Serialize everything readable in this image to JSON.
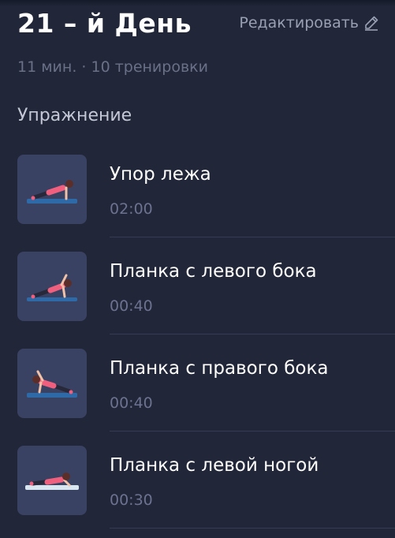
{
  "header": {
    "title": "21 – й День",
    "edit_label": "Редактировать"
  },
  "meta": "11 мин. · 10 тренировки",
  "section_label": "Упражнение",
  "exercises": [
    {
      "name": "Упор лежа",
      "duration": "02:00"
    },
    {
      "name": "Планка с левого бока",
      "duration": "00:40"
    },
    {
      "name": "Планка с правого бока",
      "duration": "00:40"
    },
    {
      "name": "Планка с левой ногой",
      "duration": "00:30"
    }
  ],
  "icons": {
    "edit": "pencil-icon"
  },
  "colors": {
    "background": "#212638",
    "thumb_background": "#394263",
    "mat": "#2f6aa8",
    "accent_pink": "#f0607e"
  }
}
